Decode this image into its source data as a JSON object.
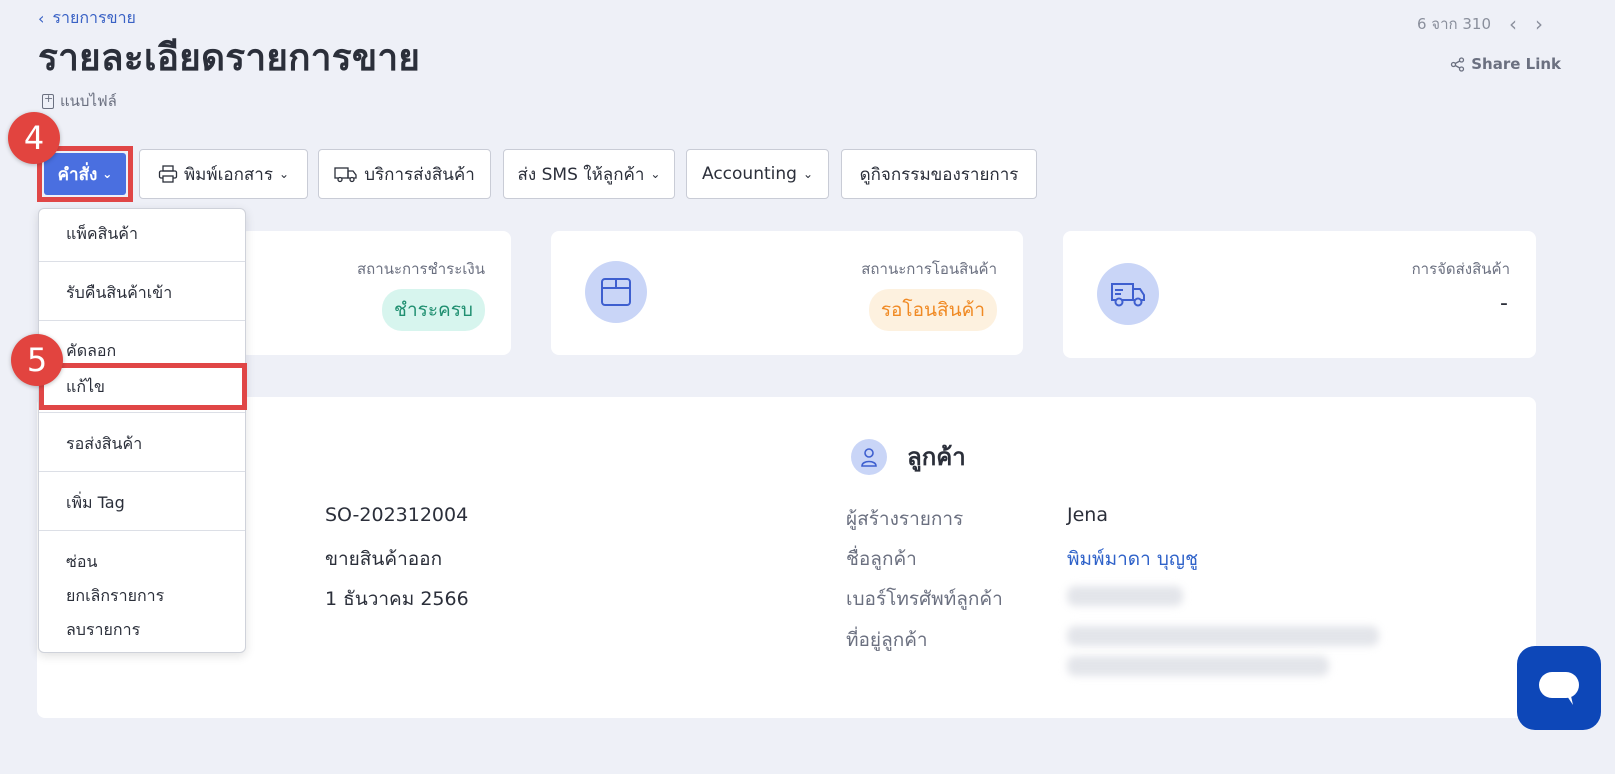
{
  "header": {
    "breadcrumb": "รายการขาย",
    "title": "รายละเอียดรายการขาย",
    "attach_label": "แนบไฟล์",
    "pager_text": "6 จาก 310",
    "share_label": "Share Link"
  },
  "toolbar": {
    "command_label": "คำสั่ง",
    "print_label": "พิมพ์เอกสาร",
    "shipping_service_label": "บริการส่งสินค้า",
    "sms_label": "ส่ง SMS ให้ลูกค้า",
    "accounting_label": "Accounting",
    "activity_label": "ดูกิจกรรมของรายการ"
  },
  "steps": {
    "step4": "4",
    "step5": "5"
  },
  "menu": {
    "items": [
      "แพ็คสินค้า",
      "รับคืนสินค้าเข้า",
      "คัดลอก",
      "แก้ไข",
      "รอส่งสินค้า",
      "เพิ่ม Tag",
      "ซ่อน",
      "ยกเลิกรายการ",
      "ลบรายการ"
    ]
  },
  "status_cards": {
    "payment": {
      "label": "สถานะการชำระเงิน",
      "value": "ชำระครบ"
    },
    "transfer": {
      "label": "สถานะการโอนสินค้า",
      "value": "รอโอนสินค้า"
    },
    "delivery": {
      "label": "การจัดส่งสินค้า",
      "value": "-"
    }
  },
  "order": {
    "number": "SO-202312004",
    "type": "ขายสินค้าออก",
    "date": "1 ธันวาคม 2566"
  },
  "customer": {
    "section_title": "ลูกค้า",
    "creator_label": "ผู้สร้างรายการ",
    "creator_value": "Jena",
    "name_label": "ชื่อลูกค้า",
    "name_value": "พิมพ์มาดา บุญชู",
    "phone_label": "เบอร์โทรศัพท์ลูกค้า",
    "address_label": "ที่อยู่ลูกค้า"
  },
  "colors": {
    "primary": "#4a6fe0",
    "highlight": "#e04646",
    "paid_bg": "#d7f5ee",
    "paid_text": "#1f8f70",
    "pending_bg": "#fdf1df",
    "pending_text": "#f08a24",
    "link": "#2f62c9"
  }
}
